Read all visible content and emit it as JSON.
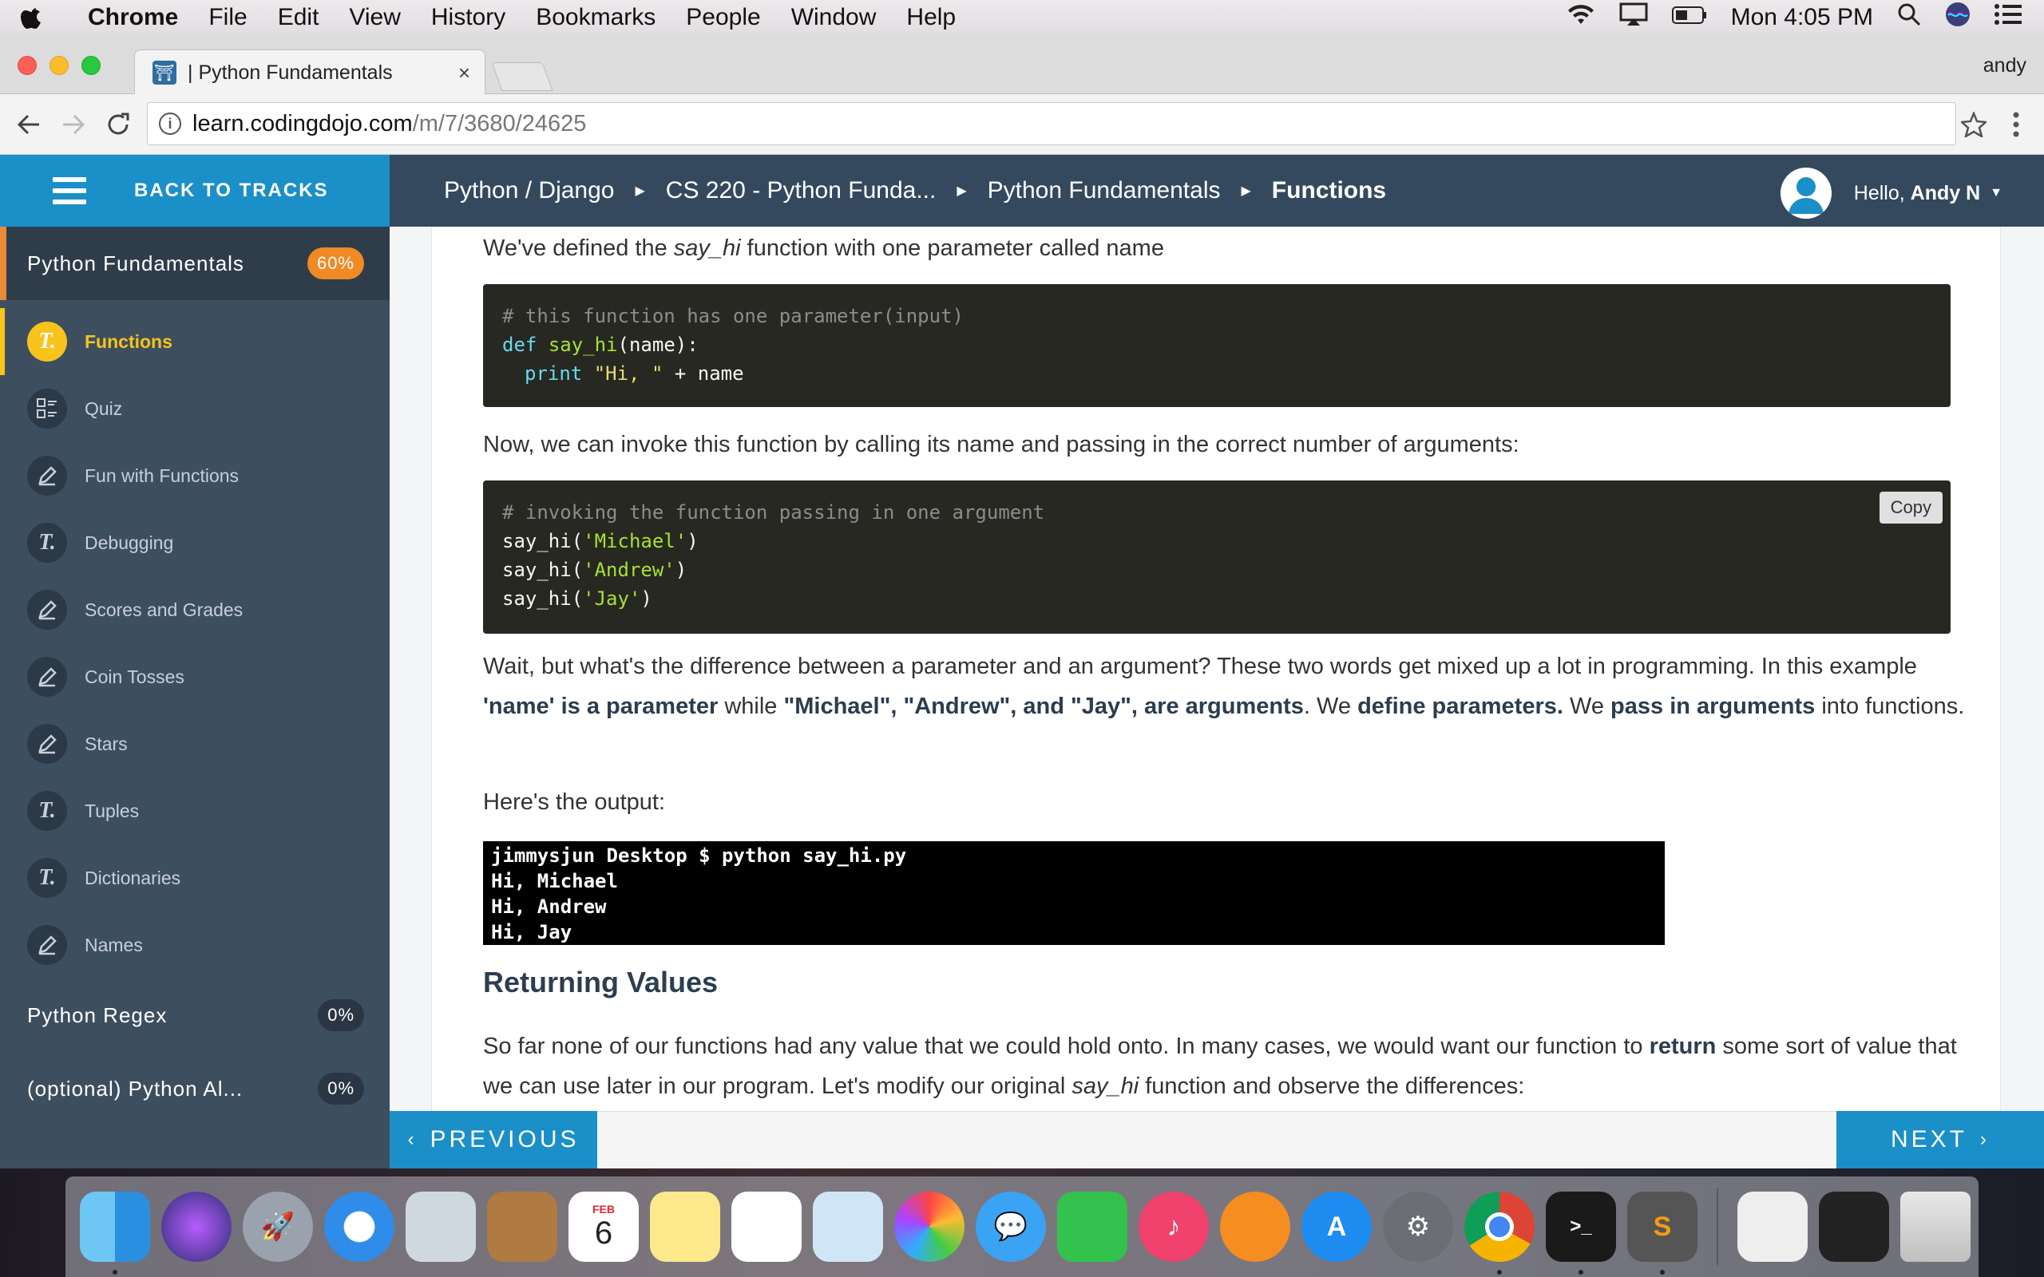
{
  "menubar": {
    "app": "Chrome",
    "items": [
      "File",
      "Edit",
      "View",
      "History",
      "Bookmarks",
      "People",
      "Window",
      "Help"
    ],
    "clock": "Mon 4:05 PM"
  },
  "browser": {
    "tab_title": "| Python Fundamentals",
    "tab_close": "×",
    "profile": "andy",
    "url_host": "learn.codingdojo.com",
    "url_path": "/m/7/3680/24625"
  },
  "header": {
    "back_label": "BACK TO TRACKS",
    "breadcrumbs": [
      "Python / Django",
      "CS 220 - Python Funda...",
      "Python Fundamentals",
      "Functions"
    ],
    "greeting": "Hello, ",
    "user": "Andy N"
  },
  "sidebar": {
    "module": {
      "title": "Python Fundamentals",
      "progress": "60%"
    },
    "items": [
      {
        "label": "Functions",
        "icon": "T"
      },
      {
        "label": "Quiz",
        "icon": "quiz"
      },
      {
        "label": "Fun with Functions",
        "icon": "pencil"
      },
      {
        "label": "Debugging",
        "icon": "T"
      },
      {
        "label": "Scores and Grades",
        "icon": "pencil"
      },
      {
        "label": "Coin Tosses",
        "icon": "pencil"
      },
      {
        "label": "Stars",
        "icon": "pencil"
      },
      {
        "label": "Tuples",
        "icon": "T"
      },
      {
        "label": "Dictionaries",
        "icon": "T"
      },
      {
        "label": "Names",
        "icon": "pencil"
      }
    ],
    "modules": [
      {
        "title": "Python Regex",
        "progress": "0%"
      },
      {
        "title": "(optional) Python Al...",
        "progress": "0%"
      }
    ]
  },
  "content": {
    "p1_pre": "We've defined the ",
    "p1_em": "say_hi",
    "p1_post": " function with one parameter called name",
    "code1": {
      "comment": "# this function has one parameter(input)",
      "kw_def": "def",
      "fn": "say_hi",
      "sig": "(name):",
      "kw_print": "print",
      "str": "\"Hi, \"",
      "rest": " + name"
    },
    "p2": "Now, we can invoke this function by calling its name and passing in the correct number of arguments:",
    "code2": {
      "comment": "# invoking the function passing in one argument",
      "copy_label": "Copy",
      "call": "say_hi(",
      "args": [
        "'Michael'",
        "'Andrew'",
        "'Jay'"
      ],
      "close": ")"
    },
    "p3_a": "Wait, but what's the difference between a parameter and an argument? These two words get mixed up a lot in programming. In this example ",
    "p3_b": "'name' is a parameter",
    "p3_c": " while ",
    "p3_d": "\"Michael\", \"Andrew\", and \"Jay\", are arguments",
    "p3_e": ". We ",
    "p3_f": "define parameters.",
    "p3_g": " We ",
    "p3_h": "pass in arguments",
    "p3_i": " into functions.",
    "p4": "Here's the output:",
    "terminal": [
      "jimmysjun Desktop $ python say_hi.py",
      "Hi, Michael",
      "Hi, Andrew",
      "Hi, Jay"
    ],
    "h_return": "Returning Values",
    "p5_a": "So far none of our functions had any value that we could hold onto. In many cases, we would want our function to ",
    "p5_b": "return",
    "p5_c": " some sort of value that we can use later in our program. Let's modify our original ",
    "p5_d": "say_hi",
    "p5_e": " function and observe the differences:"
  },
  "footer": {
    "prev": "PREVIOUS",
    "next": "NEXT"
  },
  "dock": {
    "calendar_month": "FEB",
    "calendar_day": "6"
  },
  "colors": {
    "accent_blue": "#1b8fc7",
    "header_dark": "#34495e",
    "sidebar": "#3d4e5f",
    "progress_orange": "#f08a24",
    "active_yellow": "#f8c31b"
  }
}
